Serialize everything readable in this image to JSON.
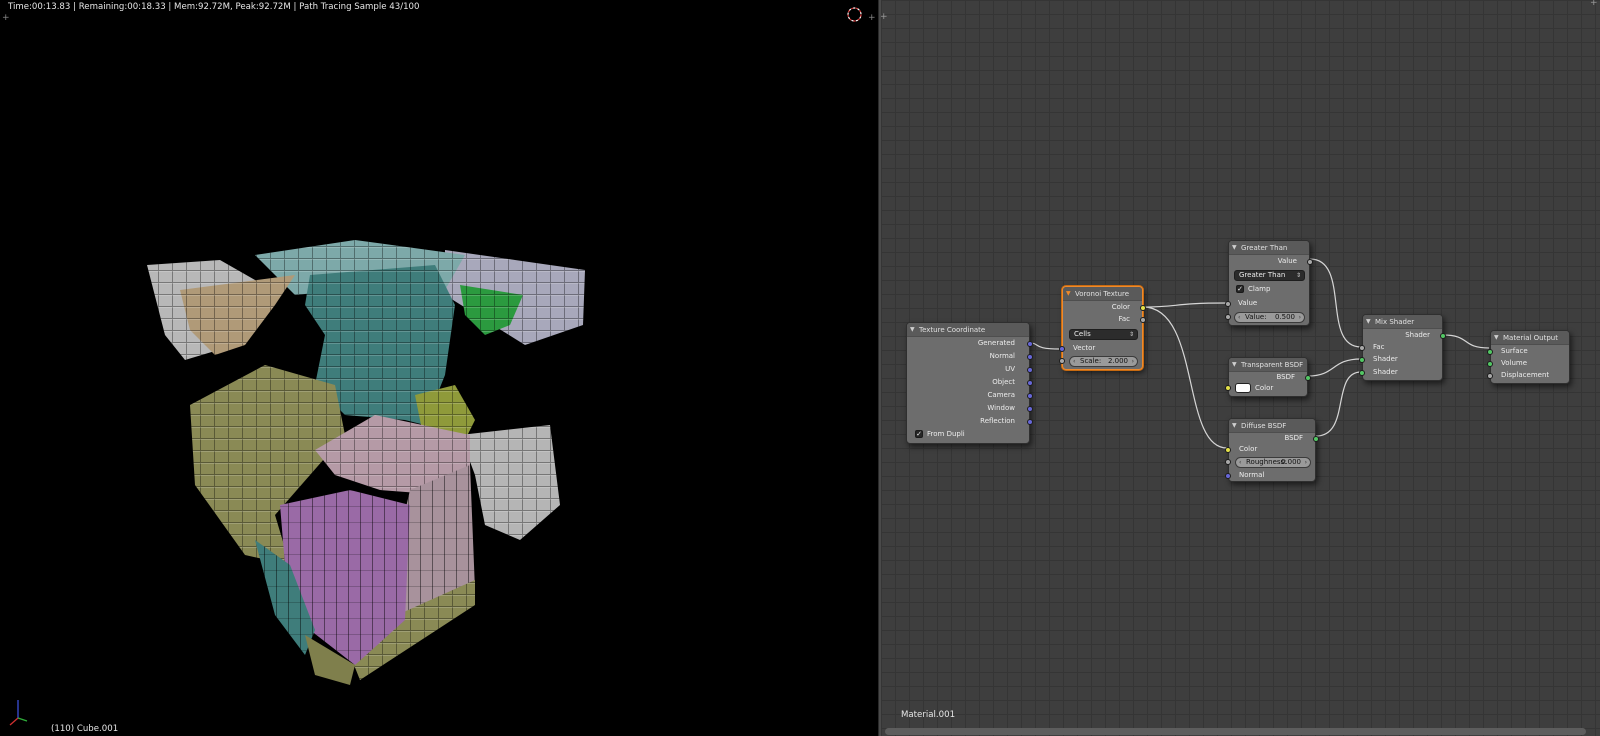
{
  "viewport": {
    "render_status": "Time:00:13.83 | Remaining:00:18.33 | Mem:92.72M, Peak:92.72M | Path Tracing Sample 43/100",
    "object_label": "(110) Cube.001",
    "corner_marker": "+"
  },
  "node_editor": {
    "material_name": "Material.001",
    "corner_marker": "+",
    "nodes": {
      "texture_coordinate": {
        "title": "Texture Coordinate",
        "outputs": [
          "Generated",
          "Normal",
          "UV",
          "Object",
          "Camera",
          "Window",
          "Reflection"
        ],
        "checkbox_label": "From Dupli",
        "checkbox_mark": "✓"
      },
      "voronoi_texture": {
        "title": "Voronoi Texture",
        "outputs": [
          "Color",
          "Fac"
        ],
        "mode": "Cells",
        "input_vector": "Vector",
        "scale_label": "Scale:",
        "scale_value": "2.000"
      },
      "greater_than": {
        "title": "Greater Than",
        "output": "Value",
        "operation": "Greater Than",
        "clamp_label": "Clamp",
        "clamp_mark": "✓",
        "input_value": "Value",
        "field_label": "Value:",
        "field_value": "0.500"
      },
      "transparent_bsdf": {
        "title": "Transparent BSDF",
        "output": "BSDF",
        "color_label": "Color"
      },
      "diffuse_bsdf": {
        "title": "Diffuse BSDF",
        "output": "BSDF",
        "color_label": "Color",
        "roughness_label": "Roughness:",
        "roughness_value": "0.000",
        "normal_label": "Normal"
      },
      "mix_shader": {
        "title": "Mix Shader",
        "output": "Shader",
        "inputs": [
          "Fac",
          "Shader",
          "Shader"
        ]
      },
      "material_output": {
        "title": "Material Output",
        "inputs": [
          "Surface",
          "Volume",
          "Displacement"
        ]
      }
    }
  },
  "colors": {
    "editor_background": "#3e3e3e",
    "node_body": "#6d6d6d",
    "selected_outline": "#f08a2a",
    "socket_color": "#e3e14a",
    "socket_float": "#a8a8a8",
    "socket_vector": "#6767d8",
    "socket_shader": "#52c764",
    "voxel_teal": "#3f7d7b",
    "voxel_olive": "#8a8a55",
    "voxel_pink": "#b59aa6",
    "voxel_purple": "#9a6aa6",
    "voxel_tan": "#b09a78",
    "voxel_gray": "#b8b8b8",
    "voxel_lavender": "#a8a8bb",
    "voxel_green": "#2b9a3f"
  }
}
